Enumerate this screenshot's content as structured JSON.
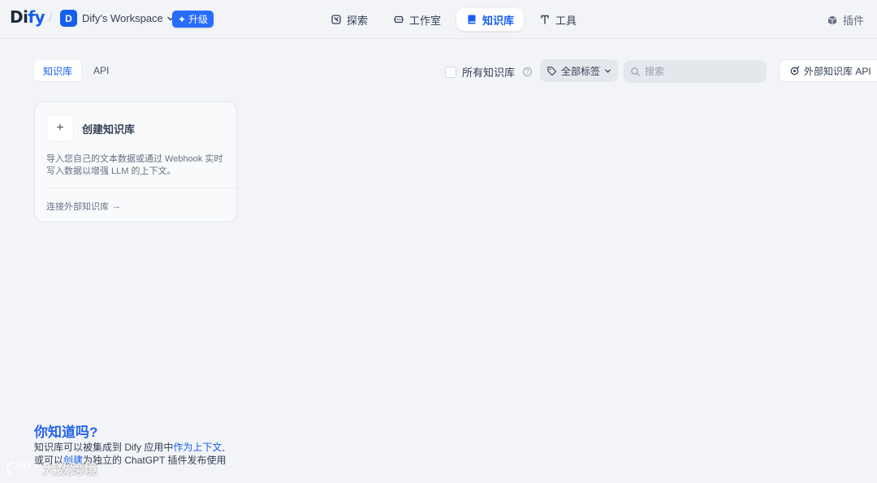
{
  "brand": {
    "logo_main": "Di",
    "logo_accent": "fy"
  },
  "workspace": {
    "avatar_letter": "D",
    "name": "Dify's Workspace",
    "upgrade_label": "升级"
  },
  "nav": {
    "items": [
      {
        "label": "探索",
        "icon": "explore-icon",
        "active": false
      },
      {
        "label": "工作室",
        "icon": "studio-icon",
        "active": false
      },
      {
        "label": "知识库",
        "icon": "book-icon",
        "active": true
      },
      {
        "label": "工具",
        "icon": "tools-icon",
        "active": false
      }
    ],
    "plugins_label": "插件"
  },
  "toolbar": {
    "tabs": [
      {
        "label": "知识库",
        "active": true
      },
      {
        "label": "API",
        "active": false
      }
    ],
    "all_kb_label": "所有知识库",
    "tag_filter_label": "全部标签",
    "search_placeholder": "搜索",
    "external_api_label": "外部知识库 API"
  },
  "create_card": {
    "title": "创建知识库",
    "description": "导入您自己的文本数据或通过 Webhook 实时写入数据以增强 LLM 的上下文。",
    "connect_label": "连接外部知识库"
  },
  "tip": {
    "title": "你知道吗?",
    "line1_prefix": "知识库可以被集成到 Dify 应用中",
    "line1_link": "作为上下文",
    "line1_suffix": ",",
    "line2_prefix": "或可以",
    "line2_link": "创建",
    "line2_suffix": "为独立的 ChatGPT 插件发布使用"
  },
  "watermark": {
    "text": "大数跨境"
  },
  "colors": {
    "accent": "#155eef",
    "background": "#f2f4f7",
    "upgrade": "#296dff"
  }
}
